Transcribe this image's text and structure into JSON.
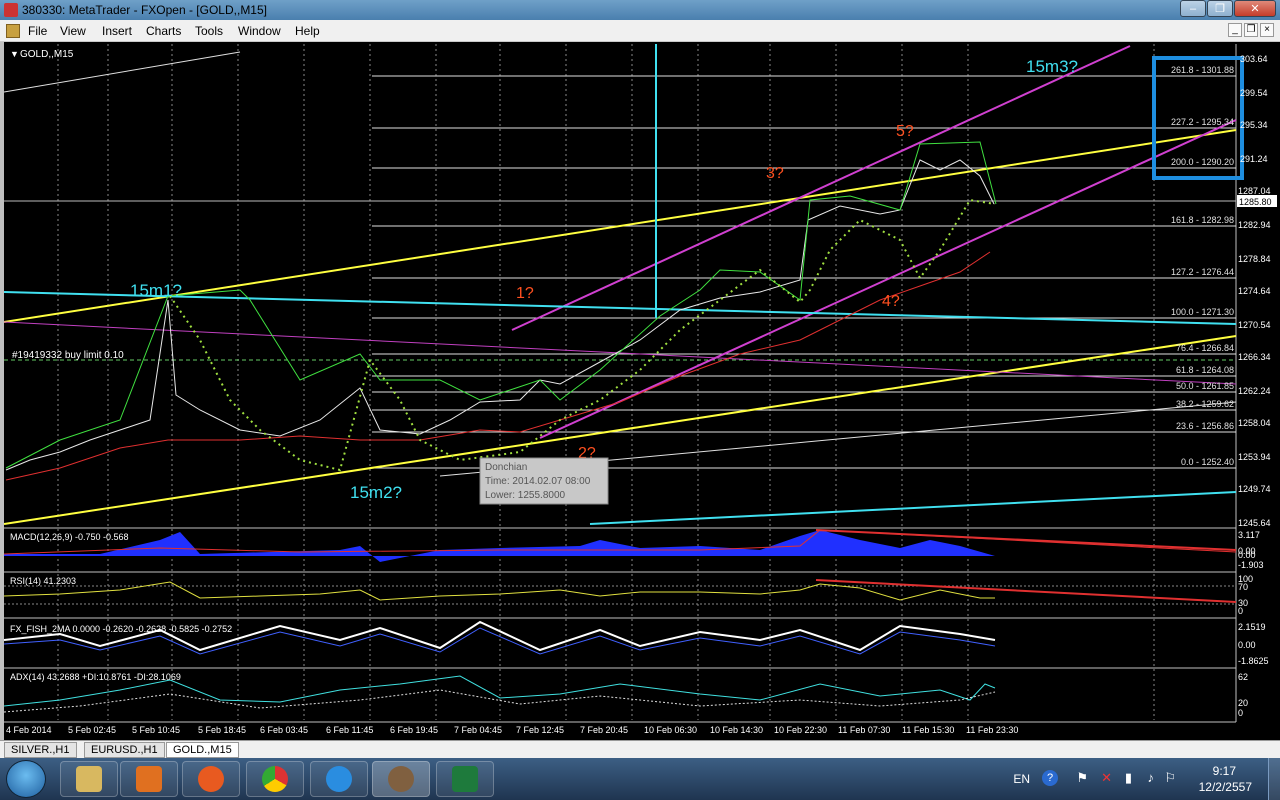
{
  "window": {
    "title": "380330: MetaTrader - FXOpen - [GOLD,,M15]",
    "controls": [
      "–",
      "❐",
      "✕"
    ]
  },
  "menu": {
    "items": [
      "File",
      "View",
      "Insert",
      "Charts",
      "Tools",
      "Window",
      "Help"
    ],
    "mdi": [
      "_",
      "❐",
      "×"
    ]
  },
  "chart": {
    "symbol_label": "GOLD,,M15",
    "order_label": "#19419332 buy limit 0.10",
    "price_axis": [
      "303.64",
      "299.54",
      "295.34",
      "291.24",
      "1287.04",
      "1282.94",
      "1278.84",
      "1274.64",
      "1270.54",
      "1266.34",
      "1262.24",
      "1258.04",
      "1253.94",
      "1249.74",
      "1245.64"
    ],
    "current_price": "1285.80",
    "time_axis": [
      "4 Feb 2014",
      "5 Feb 02:45",
      "5 Feb 10:45",
      "5 Feb 18:45",
      "6 Feb 03:45",
      "6 Feb 11:45",
      "6 Feb 19:45",
      "7 Feb 04:45",
      "7 Feb 12:45",
      "7 Feb 20:45",
      "10 Feb 06:30",
      "10 Feb 14:30",
      "10 Feb 22:30",
      "11 Feb 07:30",
      "11 Feb 15:30",
      "11 Feb 23:30"
    ],
    "fib_levels": [
      "261.8 - 1301.88",
      "227.2 - 1295.34",
      "200.0 - 1290.20",
      "161.8 - 1282.98",
      "127.2 - 1276.44",
      "100.0 - 1271.30",
      "76.4 - 1266.84",
      "61.8 - 1264.08",
      "50.0 - 1261.85",
      "38.2 - 1259.62",
      "23.6 - 1256.86",
      "0.0 - 1252.40"
    ],
    "annotations": {
      "m1": "15m1?",
      "m2": "15m2?",
      "m3": "15m3?",
      "w1": "1?",
      "w2": "2?",
      "w3": "3?",
      "w4": "4?",
      "w5": "5?"
    },
    "tooltip": {
      "name": "Donchian",
      "time": "Time: 2014.02.07 08:00",
      "lower": "Lower: 1255.8000"
    }
  },
  "indicators": {
    "macd": {
      "label": "MACD(12,26,9) -0.750 -0.568",
      "scale": [
        "3.117",
        "0.00",
        "0.00",
        "-1.903"
      ]
    },
    "rsi": {
      "label": "RSI(14) 41.2303",
      "scale": [
        "100",
        "70",
        "30",
        "0"
      ]
    },
    "fisher": {
      "label": "FX_FISH_2MA 0.0000 -0.2620 -0.2628 -0.5825 -0.2752",
      "scale": [
        "2.1519",
        "0.00",
        "-1.8625"
      ]
    },
    "adx": {
      "label": "ADX(14) 43.2688 +DI:10.8761 -DI:28.1069",
      "scale": [
        "62",
        "20",
        "0"
      ]
    }
  },
  "tabs": [
    "SILVER.,H1",
    "EURUSD.,H1",
    "GOLD.,M15"
  ],
  "active_tab": "GOLD.,M15",
  "taskbar": {
    "apps": [
      "explorer-icon",
      "media-player-icon",
      "firefox-icon",
      "chrome-icon",
      "ie-icon",
      "metatrader-icon",
      "excel-icon"
    ],
    "lang": "EN",
    "time": "9:17",
    "date": "12/2/2557"
  },
  "colors": {
    "yellow_line": "#ffff40",
    "magenta_line": "#d040d0",
    "cyan_line": "#40e0f0",
    "wave_label": "#ff5020",
    "highlight_box": "#1e8ee0"
  }
}
